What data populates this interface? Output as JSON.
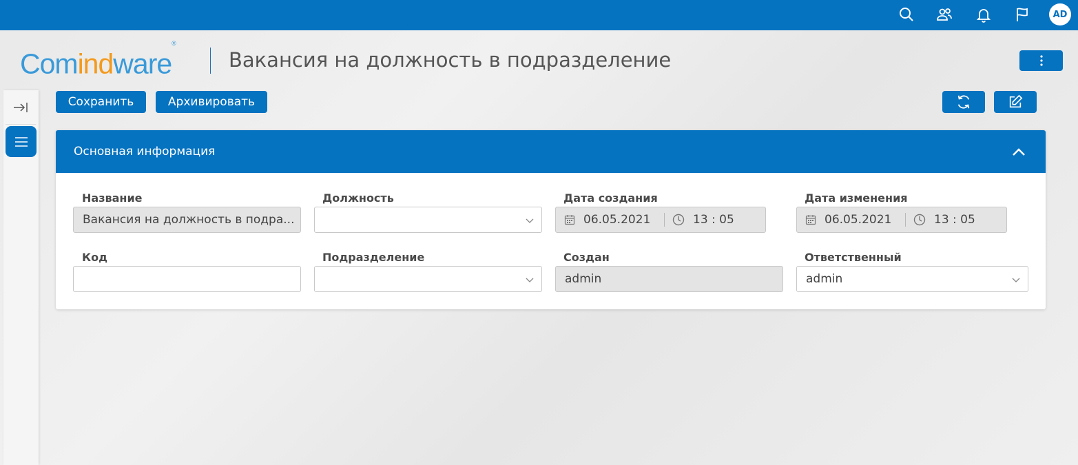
{
  "topbar": {
    "icons": [
      "search-icon",
      "users-icon",
      "bell-icon",
      "flag-icon"
    ],
    "avatar_initials": "AD",
    "color": "#0673c1"
  },
  "header": {
    "logo": {
      "part1": "Com",
      "part2": "ind",
      "part3": "ware",
      "reg": "®"
    },
    "title": "Вакансия на должность в подразделение"
  },
  "toolbar": {
    "save_label": "Сохранить",
    "archive_label": "Архивировать",
    "refresh_icon": "refresh-icon",
    "edit_icon": "edit-icon"
  },
  "section": {
    "title": "Основная информация",
    "fields": {
      "name": {
        "label": "Название",
        "value": "Вакансия на должность  в подра..."
      },
      "position": {
        "label": "Должность",
        "value": ""
      },
      "created_date": {
        "label": "Дата создания",
        "date": "06.05.2021",
        "time": "13 : 05"
      },
      "modified_date": {
        "label": "Дата изменения",
        "date": "06.05.2021",
        "time": "13 : 05"
      },
      "code": {
        "label": "Код",
        "value": ""
      },
      "department": {
        "label": "Подразделение",
        "value": ""
      },
      "created_by": {
        "label": "Создан",
        "value": "admin"
      },
      "responsible": {
        "label": "Ответственный",
        "value": "admin"
      }
    }
  }
}
